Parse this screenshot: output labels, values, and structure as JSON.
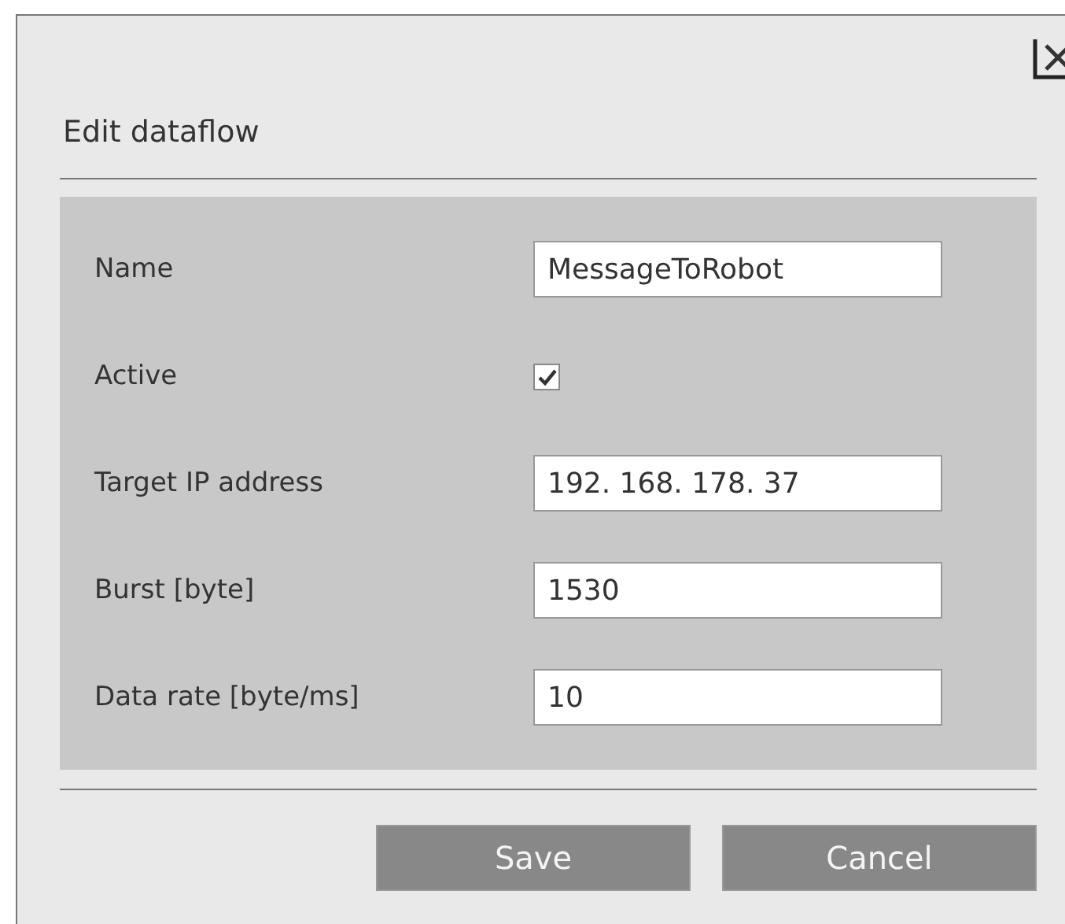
{
  "dialog": {
    "title": "Edit dataflow"
  },
  "fields": [
    {
      "kind": "text",
      "label": "Name",
      "value": "MessageToRobot"
    },
    {
      "kind": "checkbox",
      "label": "Active",
      "checked": true
    },
    {
      "kind": "text",
      "label": "Target IP address",
      "value": "192. 168. 178. 37"
    },
    {
      "kind": "text",
      "label": "Burst [byte]",
      "value": "1530"
    },
    {
      "kind": "text",
      "label": "Data rate [byte/ms]",
      "value": "10"
    }
  ],
  "buttons": [
    "Save",
    "Cancel"
  ]
}
